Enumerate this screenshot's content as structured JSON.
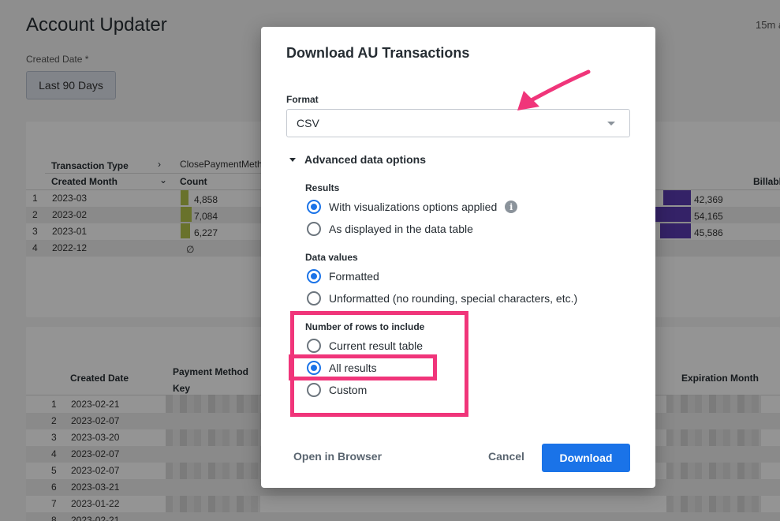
{
  "page": {
    "title": "Account Updater",
    "time_ago": "15m a",
    "filter_label": "Created Date *",
    "filter_value": "Last 90 Days"
  },
  "table1": {
    "pivot_header": "Transaction Type",
    "pivot_col": "ClosePaymentMeth",
    "row_header": "Created Month",
    "count_header": "Count",
    "right_header": "Billabl",
    "rows": [
      {
        "num": "1",
        "month": "2023-03",
        "count": "4,858",
        "right": "42,369",
        "count_frac": 0.69,
        "right_frac": 0.77
      },
      {
        "num": "2",
        "month": "2023-02",
        "count": "7,084",
        "right": "54,165",
        "count_frac": 1.0,
        "right_frac": 1.0
      },
      {
        "num": "3",
        "month": "2023-01",
        "count": "6,227",
        "right": "45,586",
        "count_frac": 0.88,
        "right_frac": 0.84
      },
      {
        "num": "4",
        "month": "2022-12",
        "count": "∅",
        "right": "",
        "count_frac": 0,
        "right_frac": 0
      }
    ]
  },
  "table2": {
    "headers": [
      "Created Date",
      "Payment Method Key",
      "Expiration Month"
    ],
    "rows": [
      {
        "num": "1",
        "date": "2023-02-21"
      },
      {
        "num": "2",
        "date": "2023-02-07"
      },
      {
        "num": "3",
        "date": "2023-03-20"
      },
      {
        "num": "4",
        "date": "2023-02-07"
      },
      {
        "num": "5",
        "date": "2023-02-07"
      },
      {
        "num": "6",
        "date": "2023-03-21"
      },
      {
        "num": "7",
        "date": "2023-01-22"
      },
      {
        "num": "8",
        "date": "2023-02-21"
      }
    ]
  },
  "dialog": {
    "title": "Download AU Transactions",
    "format_label": "Format",
    "format_value": "CSV",
    "advanced_label": "Advanced data options",
    "results_label": "Results",
    "results_options": [
      {
        "label": "With visualizations options applied",
        "selected": true
      },
      {
        "label": "As displayed in the data table",
        "selected": false
      }
    ],
    "values_label": "Data values",
    "values_options": [
      {
        "label": "Formatted",
        "selected": true
      },
      {
        "label": "Unformatted (no rounding, special characters, etc.)",
        "selected": false
      }
    ],
    "rows_label": "Number of rows to include",
    "rows_options": [
      {
        "label": "Current result table",
        "selected": false
      },
      {
        "label": "All results",
        "selected": true
      },
      {
        "label": "Custom",
        "selected": false
      }
    ],
    "open_browser": "Open in Browser",
    "cancel": "Cancel",
    "download": "Download"
  },
  "colors": {
    "accent": "#1a73e8",
    "annotation": "#f0357a",
    "bar_green": "#b5c44b",
    "bar_purple": "#5b3bb1"
  }
}
